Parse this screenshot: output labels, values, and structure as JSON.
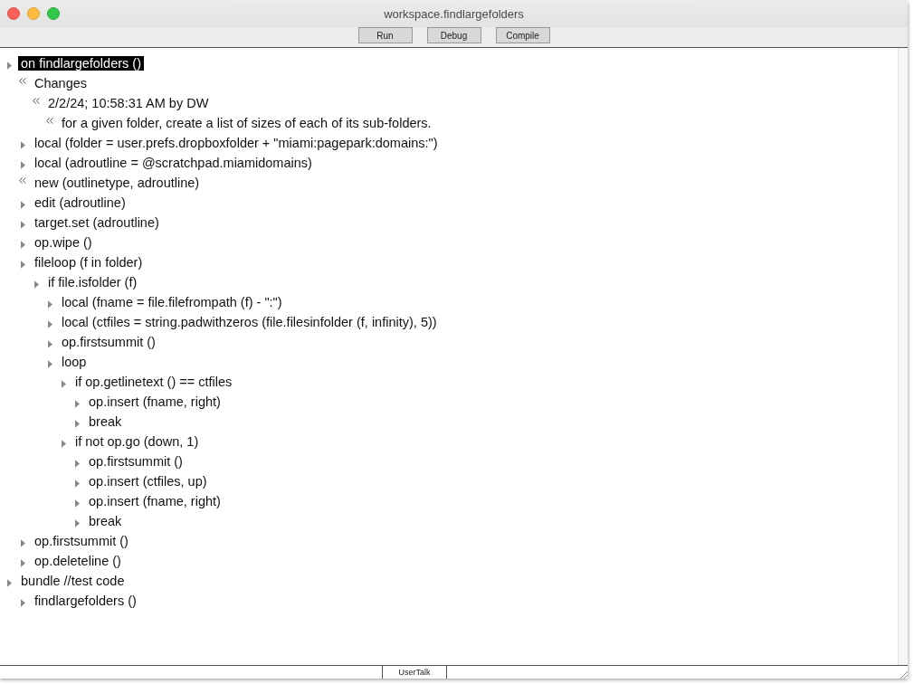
{
  "window": {
    "title": "workspace.findlargefolders"
  },
  "toolbar": {
    "buttons": [
      "Run",
      "Debug",
      "Compile"
    ]
  },
  "outline": [
    {
      "text": "on findlargefolders ()",
      "kind": "code",
      "selected": true,
      "children": [
        {
          "text": "Changes",
          "kind": "comment",
          "selected": false,
          "children": [
            {
              "text": "2/2/24; 10:58:31 AM by DW",
              "kind": "comment",
              "selected": false,
              "children": [
                {
                  "text": "for a given folder, create a list of sizes of each of its sub-folders.",
                  "kind": "comment",
                  "selected": false
                }
              ]
            }
          ]
        },
        {
          "text": "local (folder = user.prefs.dropboxfolder + \"miami:pagepark:domains:\")",
          "kind": "code",
          "selected": false
        },
        {
          "text": "local (adroutline = @scratchpad.miamidomains)",
          "kind": "code",
          "selected": false
        },
        {
          "text": "new (outlinetype, adroutline)",
          "kind": "comment",
          "selected": false
        },
        {
          "text": "edit (adroutline)",
          "kind": "code",
          "selected": false
        },
        {
          "text": "target.set (adroutline)",
          "kind": "code",
          "selected": false
        },
        {
          "text": "op.wipe ()",
          "kind": "code",
          "selected": false
        },
        {
          "text": "fileloop (f in folder)",
          "kind": "code",
          "selected": false,
          "children": [
            {
              "text": "if file.isfolder (f)",
              "kind": "code",
              "selected": false,
              "children": [
                {
                  "text": "local (fname = file.filefrompath (f) - \":\")",
                  "kind": "code",
                  "selected": false
                },
                {
                  "text": "local (ctfiles = string.padwithzeros (file.filesinfolder (f, infinity), 5))",
                  "kind": "code",
                  "selected": false
                },
                {
                  "text": "op.firstsummit ()",
                  "kind": "code",
                  "selected": false
                },
                {
                  "text": "loop",
                  "kind": "code",
                  "selected": false,
                  "children": [
                    {
                      "text": "if op.getlinetext () == ctfiles",
                      "kind": "code",
                      "selected": false,
                      "children": [
                        {
                          "text": "op.insert (fname, right)",
                          "kind": "code",
                          "selected": false
                        },
                        {
                          "text": "break",
                          "kind": "code",
                          "selected": false
                        }
                      ]
                    },
                    {
                      "text": "if not op.go (down, 1)",
                      "kind": "code",
                      "selected": false,
                      "children": [
                        {
                          "text": "op.firstsummit ()",
                          "kind": "code",
                          "selected": false
                        },
                        {
                          "text": "op.insert (ctfiles, up)",
                          "kind": "code",
                          "selected": false
                        },
                        {
                          "text": "op.insert (fname, right)",
                          "kind": "code",
                          "selected": false
                        },
                        {
                          "text": "break",
                          "kind": "code",
                          "selected": false
                        }
                      ]
                    }
                  ]
                }
              ]
            }
          ]
        },
        {
          "text": "op.firstsummit ()",
          "kind": "code",
          "selected": false
        },
        {
          "text": "op.deleteline ()",
          "kind": "code",
          "selected": false
        }
      ]
    },
    {
      "text": "bundle //test code",
      "kind": "code",
      "selected": false,
      "children": [
        {
          "text": "findlargefolders ()",
          "kind": "code",
          "selected": false
        }
      ]
    }
  ],
  "status_bar": {
    "language": "UserTalk"
  }
}
